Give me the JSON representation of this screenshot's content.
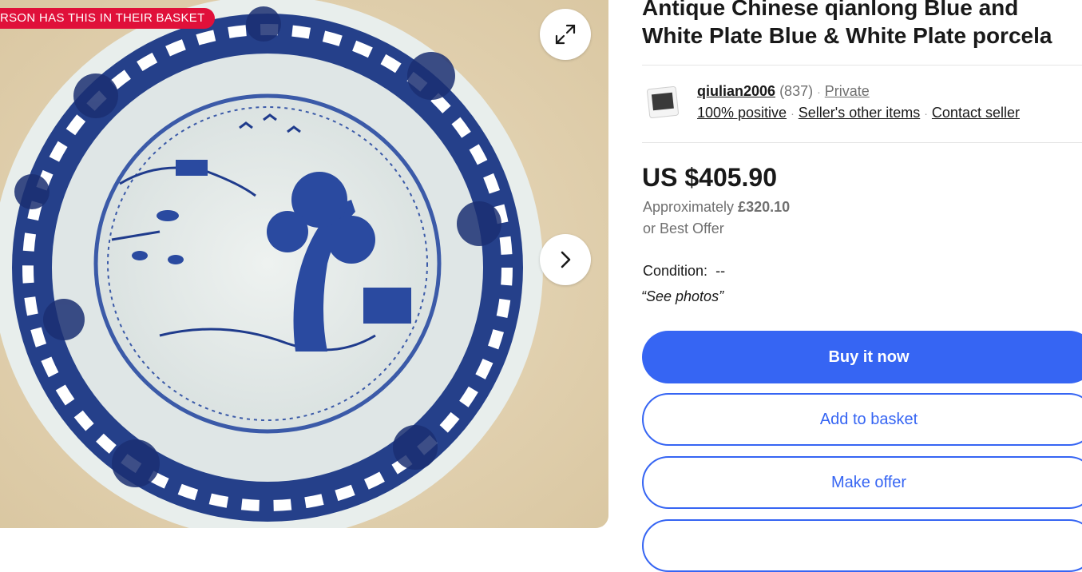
{
  "gallery": {
    "badge": "RSON HAS THIS IN THEIR BASKET",
    "expand_icon": "expand-icon",
    "next_icon": "chevron-right-icon"
  },
  "listing": {
    "title_line1": "Antique Chinese qianlong Blue and",
    "title_line2": "White Plate Blue & White Plate porcela"
  },
  "seller": {
    "name": "qiulian2006",
    "feedback_count": "(837)",
    "type": "Private",
    "positive": "100% positive",
    "other_items": "Seller's other items",
    "contact": "Contact seller"
  },
  "pricing": {
    "price": "US $405.90",
    "approx_label": "Approximately",
    "approx_value": "£320.10",
    "best_offer": "or Best Offer"
  },
  "condition": {
    "label": "Condition:",
    "value": "--",
    "note": "“See photos”"
  },
  "actions": {
    "buy_now": "Buy it now",
    "add_to_basket": "Add to basket",
    "make_offer": "Make offer"
  },
  "colors": {
    "badge": "#e0103a",
    "primary_button": "#3665f3",
    "plate_blue": "#1e3a8a"
  }
}
